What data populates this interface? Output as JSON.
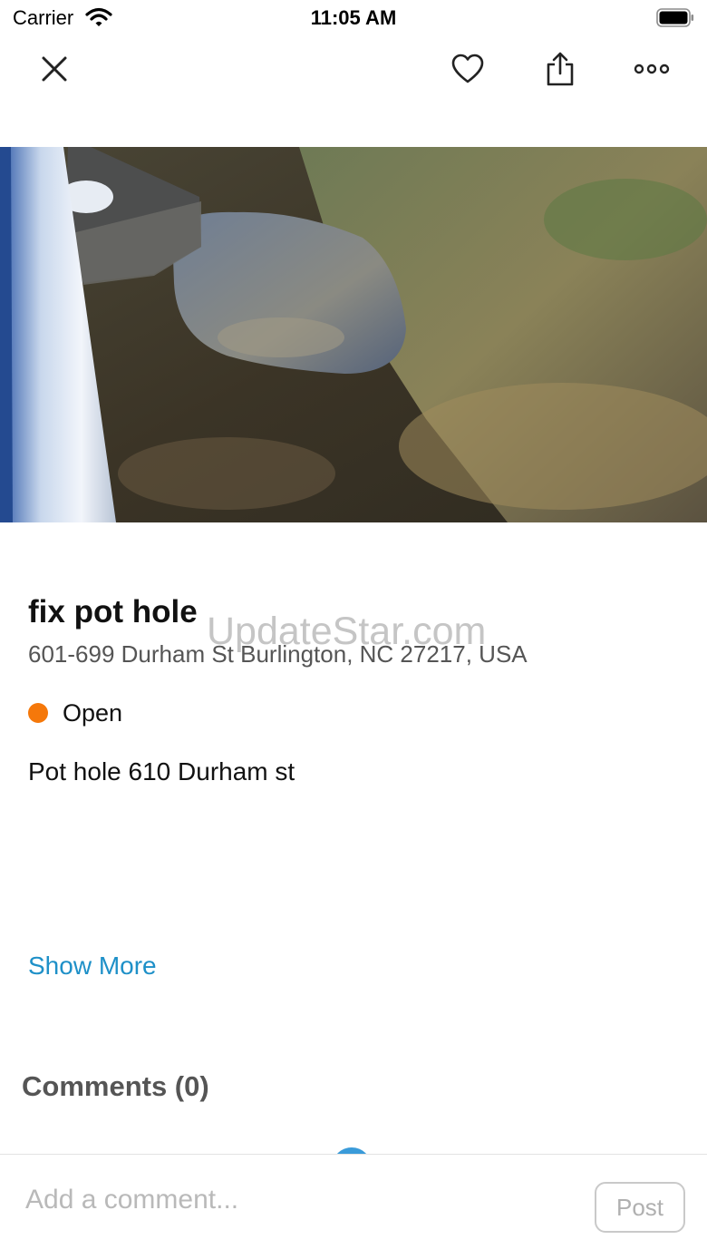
{
  "status_bar": {
    "carrier": "Carrier",
    "time": "11:05 AM",
    "icons": [
      "wifi-icon",
      "battery-icon"
    ]
  },
  "nav": {
    "icons": [
      "close-icon",
      "heart-icon",
      "share-icon",
      "more-icon"
    ]
  },
  "report": {
    "title": "fix pot hole",
    "address": "601-699 Durham St Burlington, NC 27217, USA",
    "status": "Open",
    "status_color": "#F5780A",
    "description": "Pot hole 610 Durham st",
    "show_more_label": "Show More"
  },
  "watermark": "UpdateStar.com",
  "comments": {
    "heading": "Comments (0)",
    "input_placeholder": "Add a comment...",
    "post_label": "Post"
  },
  "colors": {
    "link": "#1E90C8",
    "status_open": "#F5780A"
  }
}
